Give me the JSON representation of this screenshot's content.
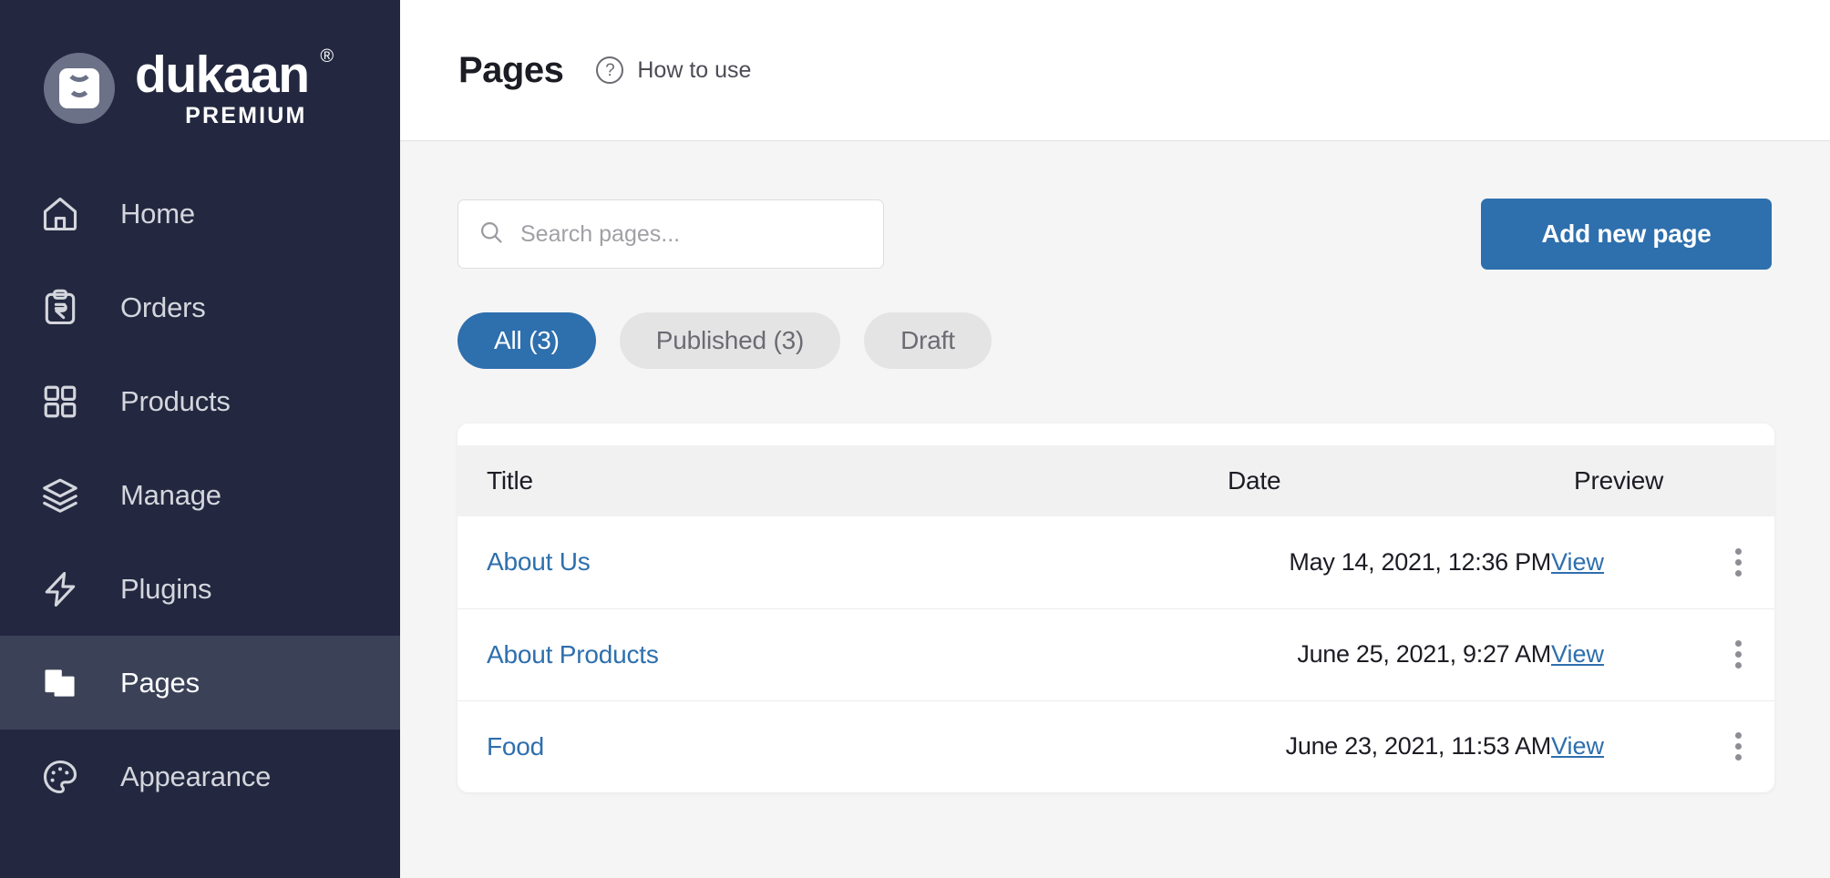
{
  "brand": {
    "name": "dukaan",
    "registered": "®",
    "tier": "PREMIUM",
    "logo_icon": "shopping-bag-icon",
    "accent_dark": "#232840",
    "accent_active": "#3b4258"
  },
  "sidebar": {
    "items": [
      {
        "label": "Home",
        "icon": "home-icon",
        "active": false
      },
      {
        "label": "Orders",
        "icon": "receipt-rupee-icon",
        "active": false
      },
      {
        "label": "Products",
        "icon": "grid-squares-icon",
        "active": false
      },
      {
        "label": "Manage",
        "icon": "layers-icon",
        "active": false
      },
      {
        "label": "Plugins",
        "icon": "bolt-icon",
        "active": false
      },
      {
        "label": "Pages",
        "icon": "pages-icon",
        "active": true
      },
      {
        "label": "Appearance",
        "icon": "palette-icon",
        "active": false
      }
    ]
  },
  "header": {
    "title": "Pages",
    "help_label": "How to use",
    "help_icon": "question-circle-icon"
  },
  "toolbar": {
    "search": {
      "placeholder": "Search pages...",
      "value": "",
      "icon": "search-icon"
    },
    "add_button_label": "Add new page",
    "accent_color": "#2e6fad"
  },
  "filters": [
    {
      "label": "All (3)",
      "active": true
    },
    {
      "label": "Published (3)",
      "active": false
    },
    {
      "label": "Draft",
      "active": false
    }
  ],
  "table": {
    "columns": {
      "title": "Title",
      "date": "Date",
      "preview": "Preview"
    },
    "view_label": "View",
    "menu_icon": "more-vertical-icon",
    "rows": [
      {
        "title": "About Us",
        "date": "May 14, 2021, 12:36 PM"
      },
      {
        "title": "About Products",
        "date": "June 25, 2021, 9:27 AM"
      },
      {
        "title": "Food",
        "date": "June 23, 2021, 11:53 AM"
      }
    ]
  }
}
